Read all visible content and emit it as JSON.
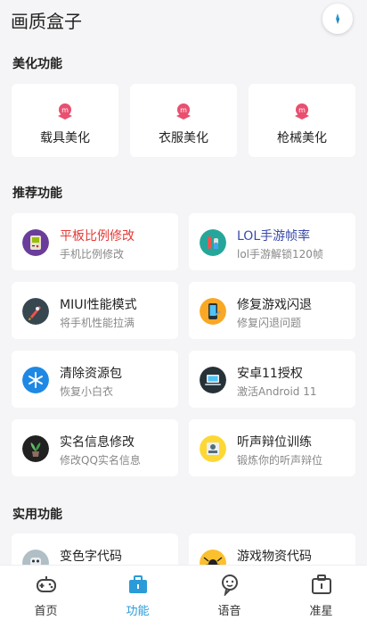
{
  "header": {
    "title": "画质盒子"
  },
  "sections": {
    "beauty": "美化功能",
    "recommend": "推荐功能",
    "utility": "实用功能"
  },
  "beauty_items": [
    {
      "label": "载具美化",
      "icon": "badge-m-icon"
    },
    {
      "label": "衣服美化",
      "icon": "badge-m-icon"
    },
    {
      "label": "枪械美化",
      "icon": "badge-m-icon"
    }
  ],
  "features": [
    {
      "title": "平板比例修改",
      "subtitle": "手机比例修改",
      "icon": "game-console-icon",
      "title_color": "#e53935"
    },
    {
      "title": "LOL手游帧率",
      "subtitle": "lol手游解锁120帧",
      "icon": "potion-icon",
      "title_color": "#3949ab"
    },
    {
      "title": "MIUI性能模式",
      "subtitle": "将手机性能拉满",
      "icon": "rocket-icon",
      "title_color": "#222222"
    },
    {
      "title": "修复游戏闪退",
      "subtitle": "修复闪退问题",
      "icon": "phone-repair-icon",
      "title_color": "#222222"
    },
    {
      "title": "清除资源包",
      "subtitle": "恢复小白衣",
      "icon": "snowflake-icon",
      "title_color": "#222222"
    },
    {
      "title": "安卓11授权",
      "subtitle": "激活Android 11",
      "icon": "laptop-icon",
      "title_color": "#222222"
    },
    {
      "title": "实名信息修改",
      "subtitle": "修改QQ实名信息",
      "icon": "plant-icon",
      "title_color": "#222222"
    },
    {
      "title": "听声辩位训练",
      "subtitle": "锻炼你的听声辩位",
      "icon": "id-card-icon",
      "title_color": "#222222"
    }
  ],
  "utility_items": [
    {
      "title": "变色字代码",
      "icon": "robot-icon"
    },
    {
      "title": "游戏物资代码",
      "icon": "spider-icon"
    }
  ],
  "nav": [
    {
      "label": "首页",
      "icon": "gamepad-icon",
      "active": false
    },
    {
      "label": "功能",
      "icon": "toolbox-icon",
      "active": true
    },
    {
      "label": "语音",
      "icon": "chat-face-icon",
      "active": false
    },
    {
      "label": "准星",
      "icon": "crosshair-box-icon",
      "active": false
    }
  ],
  "colors": {
    "accent": "#2a9bd8",
    "badge": "#e94f6f",
    "red_title": "#e53935",
    "blue_title": "#3949ab"
  }
}
